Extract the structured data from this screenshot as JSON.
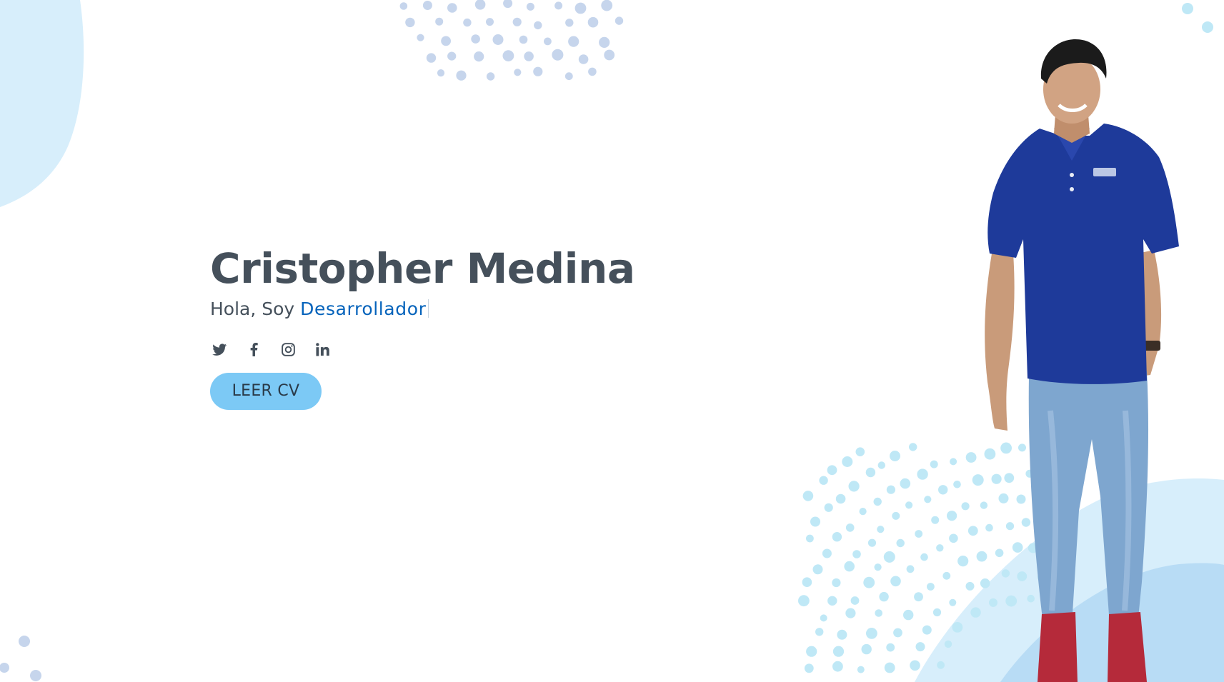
{
  "hero": {
    "name": "Cristopher Medina",
    "greeting": "Hola, Soy",
    "role": "Desarrollador",
    "cv_button_label": "LEER CV"
  },
  "social": [
    {
      "network": "twitter",
      "icon": "twitter-icon"
    },
    {
      "network": "facebook",
      "icon": "facebook-icon"
    },
    {
      "network": "instagram",
      "icon": "instagram-icon"
    },
    {
      "network": "linkedin",
      "icon": "linkedin-icon"
    }
  ],
  "portrait": {
    "icon": "person-photo"
  },
  "colors": {
    "heading_text": "#45505b",
    "accent_text": "#0563bb",
    "button_bg": "#7cc9f5",
    "blob_light": "#d7eefb",
    "blob_mid": "#b8dcf5",
    "dots_blue": "#c6d5ec",
    "dots_cyan": "#bfe8f6"
  }
}
